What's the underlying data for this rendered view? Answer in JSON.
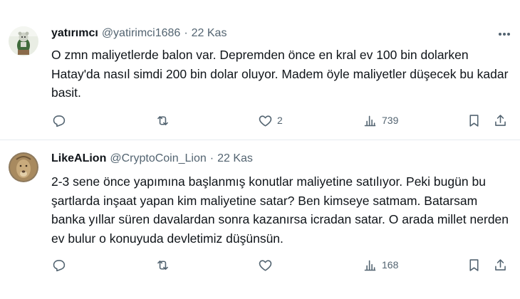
{
  "tweets": [
    {
      "name": "yatırımcı",
      "handle": "@yatirimci1686",
      "separator": "·",
      "date": "22 Kas",
      "text": "O zmn maliyetlerde balon var. Depremden önce en kral ev 100 bin dolarken Hatay'da nasıl simdi 200 bin dolar oluyor. Madem öyle maliyetler düşecek bu kadar basit.",
      "reply_count": "",
      "retweet_count": "",
      "like_count": "2",
      "view_count": "739",
      "avatar_icon": "bear-avatar-icon"
    },
    {
      "name": "LikeALion",
      "handle": "@CryptoCoin_Lion",
      "separator": "·",
      "date": "22 Kas",
      "text": "2-3 sene önce yapımına başlanmış konutlar maliyetine satılıyor. Peki bugün bu şartlarda inşaat yapan kim maliyetine satar? Ben kimseye satmam. Batarsam banka yıllar süren davalardan sonra kazanırsa icradan satar. O arada millet nerden ev bulur o konuyuda devletimiz düşünsün.",
      "reply_count": "",
      "retweet_count": "",
      "like_count": "",
      "view_count": "168",
      "avatar_icon": "lion-avatar-icon"
    }
  ],
  "icons": [
    "reply-icon",
    "retweet-icon",
    "like-icon",
    "views-icon",
    "bookmark-icon",
    "share-icon",
    "more-icon"
  ],
  "colors": {
    "text": "#0f1419",
    "secondary": "#536471",
    "divider": "#e6ecf0"
  }
}
